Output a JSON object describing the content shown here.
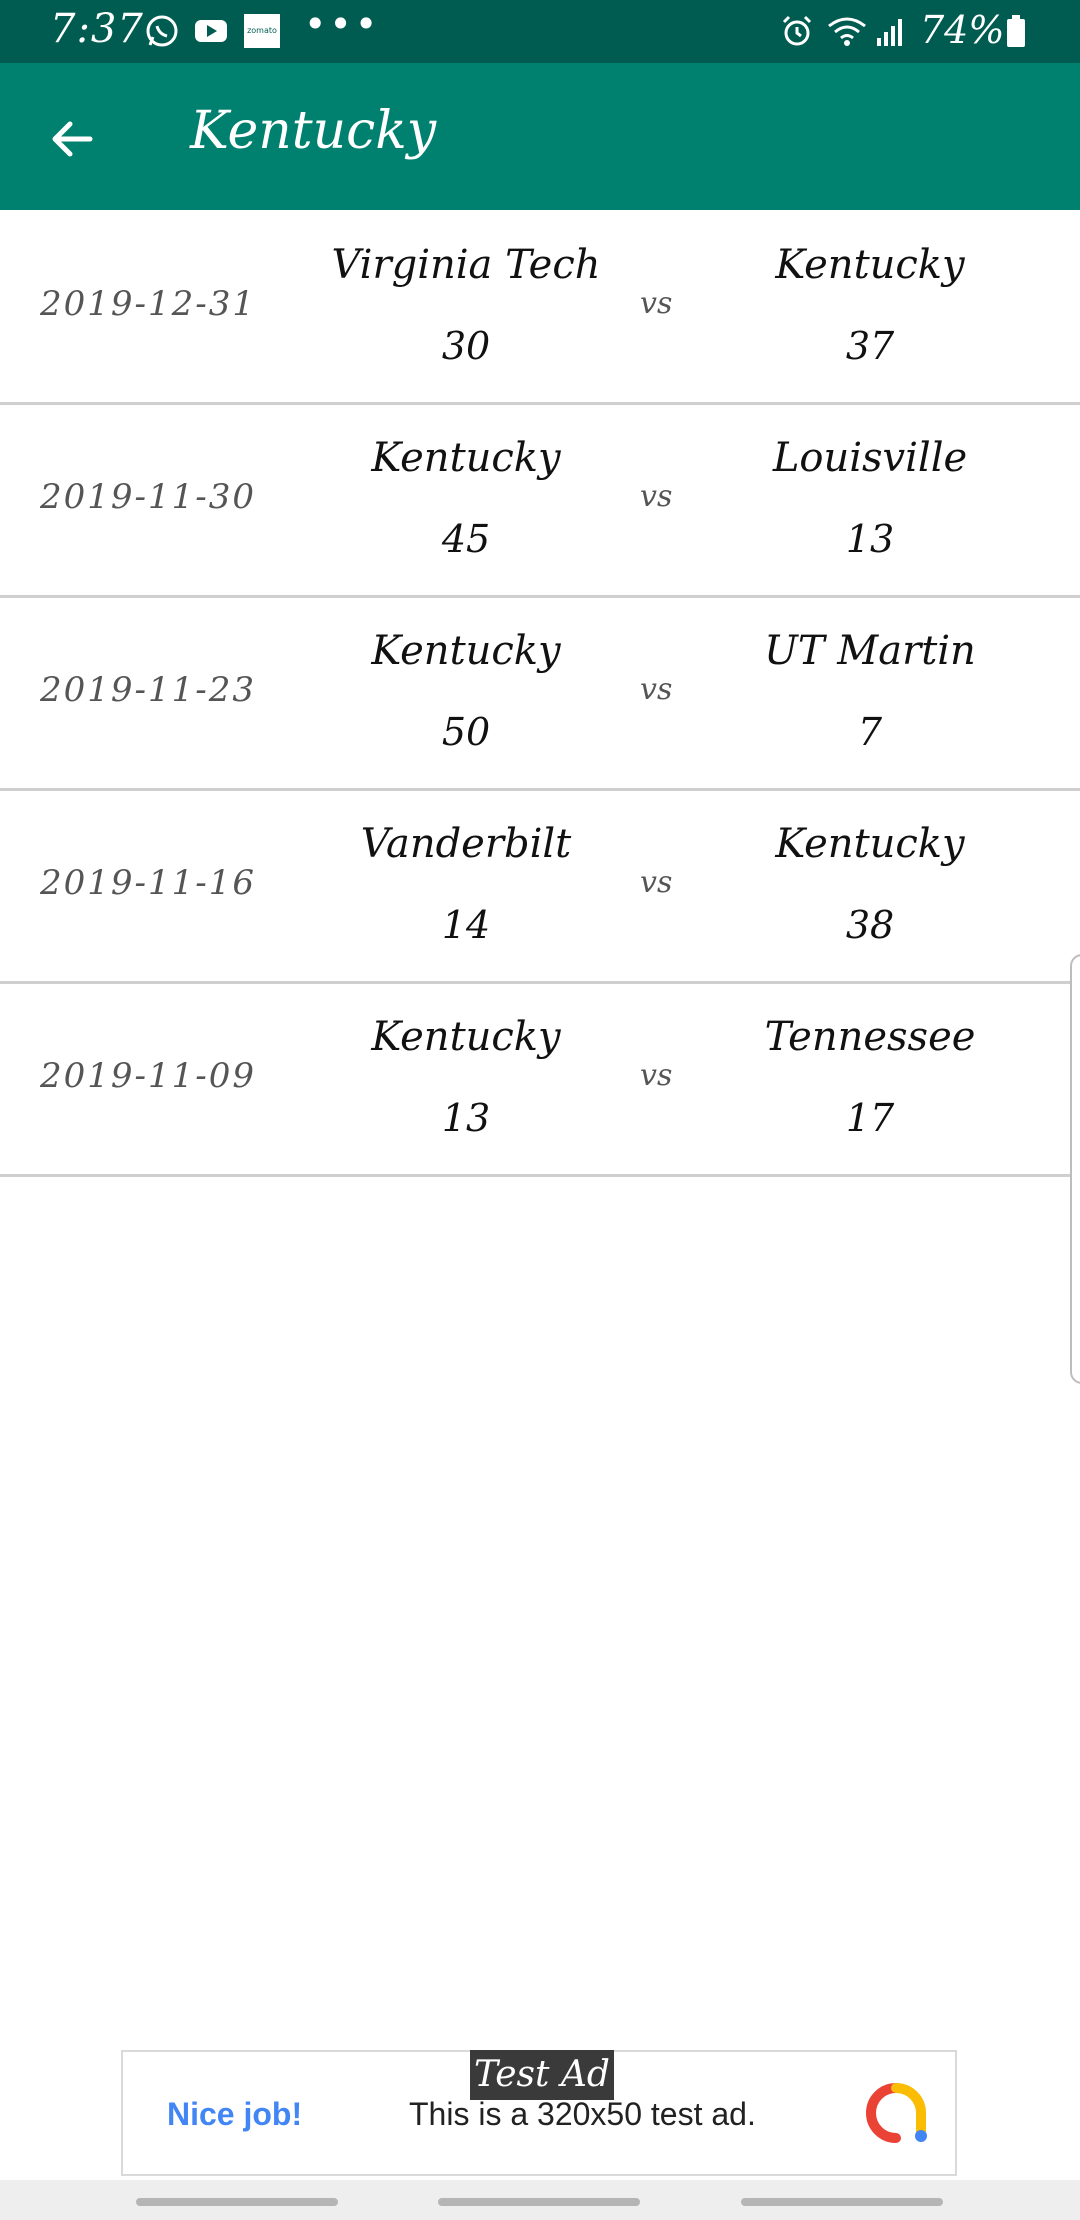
{
  "status_bar": {
    "time": "7:37",
    "dots": "•••",
    "battery": "74%",
    "icons": [
      "whatsapp-icon",
      "youtube-icon",
      "zomato-icon",
      "alarm-icon",
      "wifi-icon",
      "signal-icon",
      "battery-icon"
    ],
    "zomato_label": "zomato"
  },
  "app_bar": {
    "title": "Kentucky",
    "back_icon": "arrow-left-icon",
    "color": "#00806f"
  },
  "games": [
    {
      "date": "2019-12-31",
      "home_team": "Virginia Tech",
      "home_score": "30",
      "vs": "vs",
      "away_team": "Kentucky",
      "away_score": "37"
    },
    {
      "date": "2019-11-30",
      "home_team": "Kentucky",
      "home_score": "45",
      "vs": "vs",
      "away_team": "Louisville",
      "away_score": "13"
    },
    {
      "date": "2019-11-23",
      "home_team": "Kentucky",
      "home_score": "50",
      "vs": "vs",
      "away_team": "UT Martin",
      "away_score": "7"
    },
    {
      "date": "2019-11-16",
      "home_team": "Vanderbilt",
      "home_score": "14",
      "vs": "vs",
      "away_team": "Kentucky",
      "away_score": "38"
    },
    {
      "date": "2019-11-09",
      "home_team": "Kentucky",
      "home_score": "13",
      "vs": "vs",
      "away_team": "Tennessee",
      "away_score": "17"
    }
  ],
  "ad": {
    "badge": "Test Ad",
    "cta": "Nice job!",
    "text": "This is a 320x50 test ad."
  }
}
